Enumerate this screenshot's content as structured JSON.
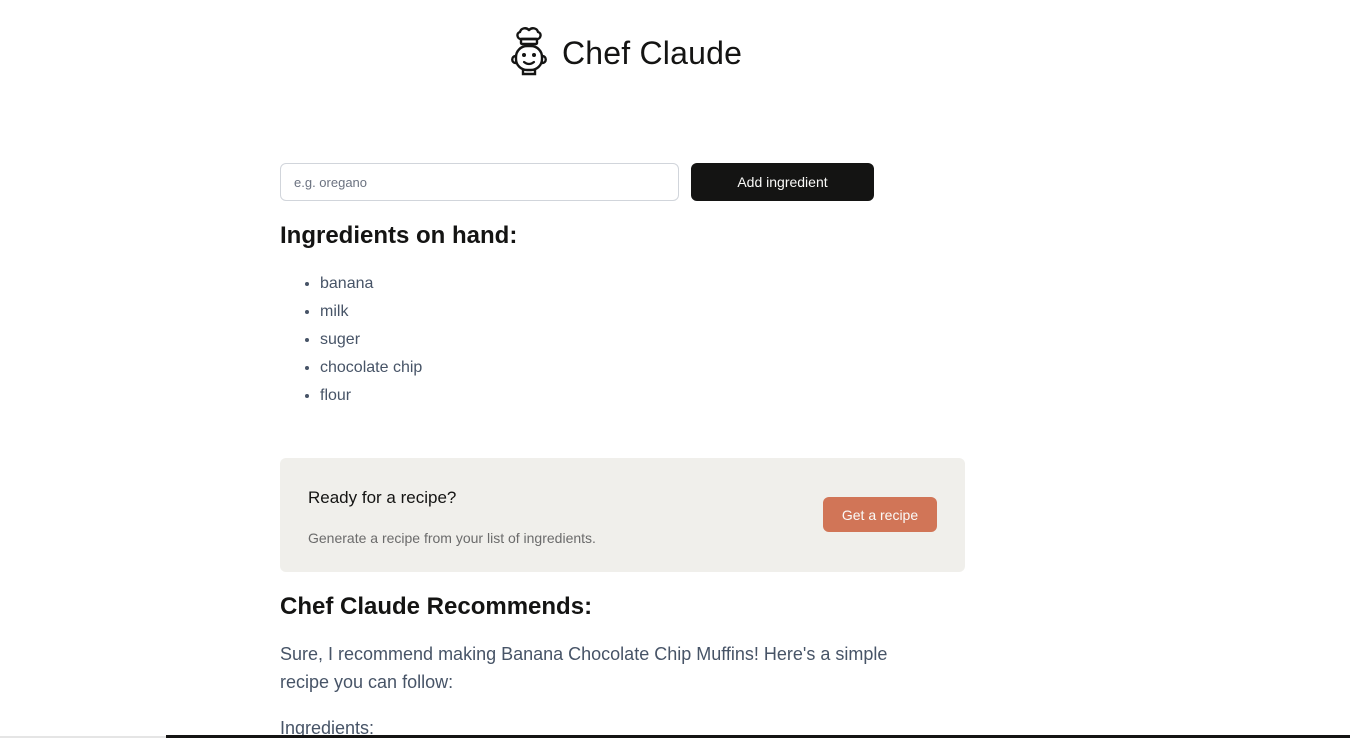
{
  "header": {
    "brand": "Chef Claude",
    "logo_icon": "chef-hat-face-icon"
  },
  "form": {
    "input_placeholder": "e.g. oregano",
    "input_value": "",
    "add_button_label": "Add ingredient"
  },
  "ingredients": {
    "heading": "Ingredients on hand:",
    "items": [
      "banana",
      "milk",
      "suger",
      "chocolate chip",
      "flour"
    ]
  },
  "recipe_card": {
    "title": "Ready for a recipe?",
    "description": "Generate a recipe from your list of ingredients.",
    "button_label": "Get a recipe"
  },
  "recommendation": {
    "heading": "Chef Claude Recommends:",
    "intro": "Sure, I recommend making Banana Chocolate Chip Muffins! Here's a simple recipe you can follow:",
    "subheading": "Ingredients:"
  },
  "colors": {
    "primary_dark": "#141413",
    "accent": "#d17557",
    "card_bg": "#f0efeb",
    "body_text": "#475467"
  }
}
